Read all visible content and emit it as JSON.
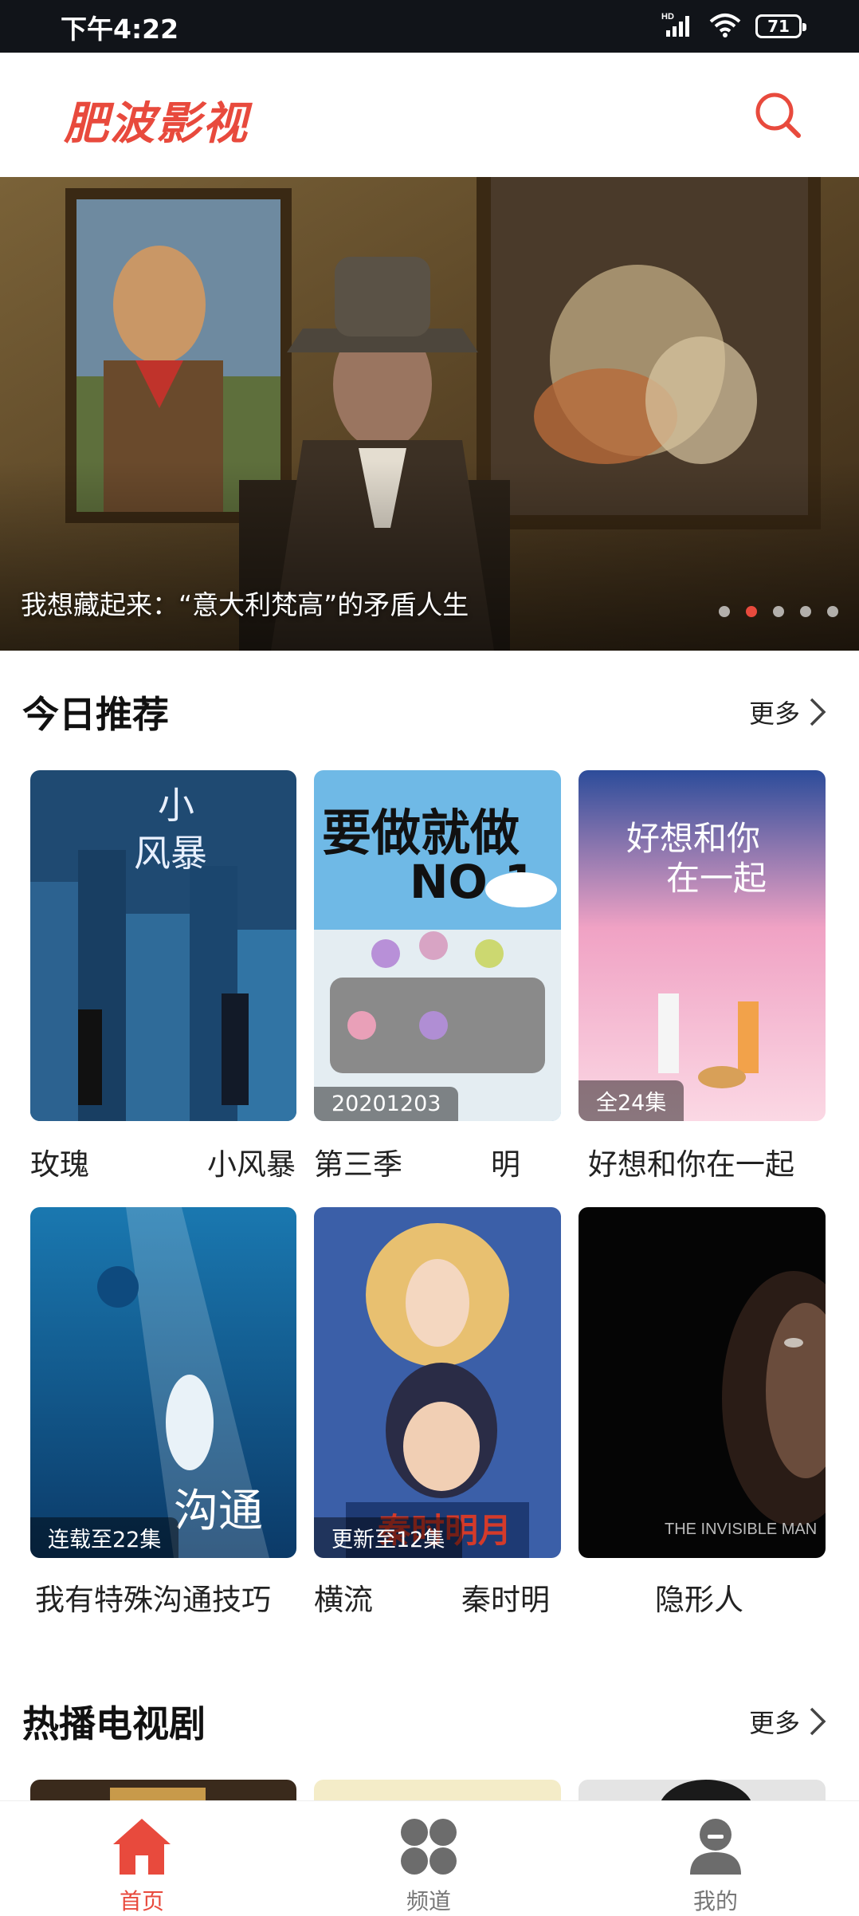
{
  "status_bar": {
    "time": "下午4:22",
    "network": "HD",
    "battery": "71"
  },
  "header": {
    "app_name": "肥波影视",
    "search_icon": "search-icon",
    "accent_color": "#e84a3d"
  },
  "banner": {
    "title": "我想藏起来：“意大利梵高”的矛盾人生",
    "slide_count": 5,
    "active_slide": 2
  },
  "today_section": {
    "title": "今日推荐",
    "more_label": "更多"
  },
  "today_items": [
    {
      "badge": "",
      "caption": "玫瑰　　　　小风暴"
    },
    {
      "badge": "20201203",
      "caption": "第三季　　　明"
    },
    {
      "badge": "全24集",
      "caption": "好想和你在一起"
    },
    {
      "badge": "连载至22集",
      "caption": "我有特殊沟通技巧"
    },
    {
      "badge": "更新至12集",
      "caption": "横流　　　秦时明"
    },
    {
      "badge": "",
      "caption": "隐形人"
    }
  ],
  "tv_section": {
    "title": "热播电视剧",
    "more_label": "更多"
  },
  "bottom_nav": [
    {
      "label": "首页",
      "icon": "home-icon"
    },
    {
      "label": "频道",
      "icon": "channels-icon"
    },
    {
      "label": "我的",
      "icon": "profile-icon"
    }
  ]
}
